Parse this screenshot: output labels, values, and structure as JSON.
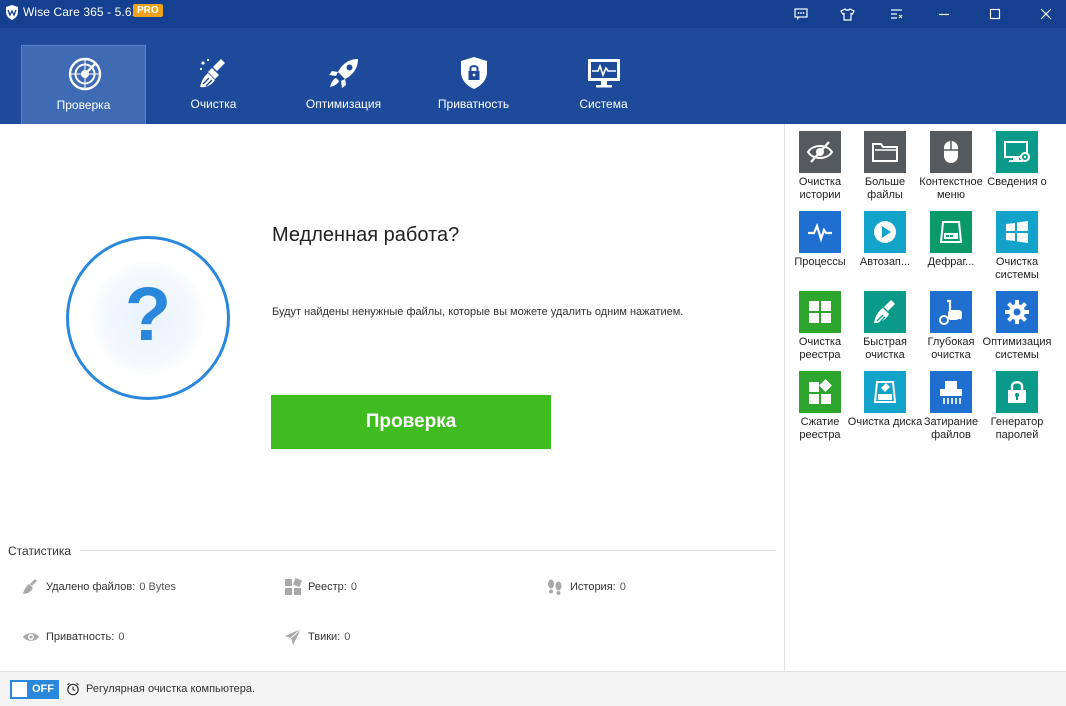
{
  "titlebar": {
    "title": "Wise Care 365 - 5.6.7",
    "badge": "PRO",
    "buttons": [
      "feedback-icon",
      "skin-icon",
      "menu-icon",
      "minimize-icon",
      "maximize-icon",
      "close-icon"
    ]
  },
  "nav": {
    "items": [
      {
        "label": "Проверка",
        "icon": "radar-icon",
        "active": true
      },
      {
        "label": "Очистка",
        "icon": "broom-icon",
        "active": false
      },
      {
        "label": "Оптимизация",
        "icon": "rocket-icon",
        "active": false
      },
      {
        "label": "Приватность",
        "icon": "shield-lock-icon",
        "active": false
      },
      {
        "label": "Система",
        "icon": "monitor-icon",
        "active": false
      }
    ]
  },
  "main": {
    "status_symbol": "?",
    "headline": "Медленная работа?",
    "description": "Будут найдены ненужные файлы, которые вы можете удалить одним нажатием.",
    "scan_button": "Проверка"
  },
  "stats": {
    "title": "Статистика",
    "items": [
      {
        "label": "Удалено файлов:",
        "value": "0 Bytes",
        "icon": "broom-icon"
      },
      {
        "label": "Реестр:",
        "value": "0",
        "icon": "registry-icon"
      },
      {
        "label": "История:",
        "value": "0",
        "icon": "footprints-icon"
      },
      {
        "label": "Приватность:",
        "value": "0",
        "icon": "eye-icon"
      },
      {
        "label": "Твики:",
        "value": "0",
        "icon": "paper-plane-icon"
      }
    ]
  },
  "tools": [
    {
      "label": "Очистка истории",
      "color": "#555a5e",
      "icon": "eye-slash-icon"
    },
    {
      "label": "Больше файлы",
      "color": "#555a5e",
      "icon": "folder-icon"
    },
    {
      "label": "Контекстное меню",
      "color": "#555a5e",
      "icon": "mouse-icon"
    },
    {
      "label": "Сведения о",
      "color": "#0a9a8a",
      "icon": "monitor-gear-icon"
    },
    {
      "label": "Процессы",
      "color": "#1f6fd0",
      "icon": "pulse-icon"
    },
    {
      "label": "Автозап...",
      "color": "#13a2c9",
      "icon": "play-icon"
    },
    {
      "label": "Дефраг...",
      "color": "#0a9a6a",
      "icon": "disk-icon"
    },
    {
      "label": "Очистка системы",
      "color": "#13a2c9",
      "icon": "windows-icon"
    },
    {
      "label": "Очистка реестра",
      "color": "#2ea52e",
      "icon": "grid-icon"
    },
    {
      "label": "Быстрая очистка",
      "color": "#0a9a8a",
      "icon": "broom-icon"
    },
    {
      "label": "Глубокая очистка",
      "color": "#1f6fd0",
      "icon": "vacuum-icon"
    },
    {
      "label": "Оптимизация системы",
      "color": "#1f6fd0",
      "icon": "gear-icon"
    },
    {
      "label": "Сжатие реестра",
      "color": "#2ea52e",
      "icon": "compress-grid-icon"
    },
    {
      "label": "Очистка диска",
      "color": "#13a2c9",
      "icon": "disk-clean-icon"
    },
    {
      "label": "Затирание файлов",
      "color": "#1f6fd0",
      "icon": "shredder-icon"
    },
    {
      "label": "Генератор паролей",
      "color": "#0a9a8a",
      "icon": "padlock-icon"
    }
  ],
  "footer": {
    "toggle": "OFF",
    "text": "Регулярная очистка компьютера."
  }
}
